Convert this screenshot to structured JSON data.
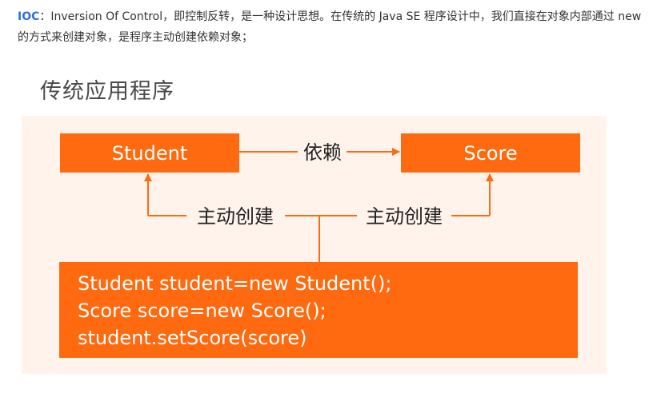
{
  "intro": {
    "keyword": "IOC",
    "text": "：Inversion Of Control，即控制反转，是一种设计思想。在传统的 Java SE 程序设计中，我们直接在对象内部通过 new 的方式来创建对象，是程序主动创建依赖对象；"
  },
  "figure": {
    "title": "传统应用程序",
    "student_box": "Student",
    "score_box": "Score",
    "depends_label": "依赖",
    "create_left_label": "主动创建",
    "create_right_label": "主动创建",
    "code_lines": [
      "Student student=new Student();",
      "Score score=new Score();",
      "student.setScore(score)"
    ]
  },
  "colors": {
    "accent": "#ff6a10",
    "canvas_bg": "#fff3eb",
    "keyword": "#2f6fde"
  }
}
